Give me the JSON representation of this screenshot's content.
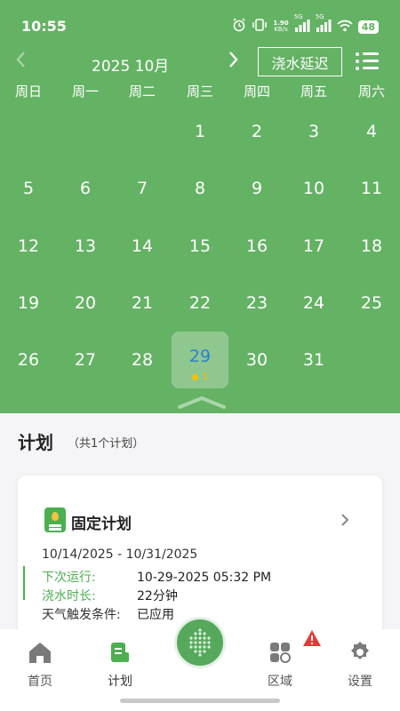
{
  "status_bar": {
    "time": "10:55",
    "speed_value": "1.90",
    "speed_unit": "KB/s",
    "signal_1": "5G",
    "signal_2": "5G",
    "battery": "48"
  },
  "calendar": {
    "month_label": "2025 10月",
    "delay_button": "浇水延迟",
    "weekdays": [
      "周日",
      "周一",
      "周二",
      "周三",
      "周四",
      "周五",
      "周六"
    ],
    "start_weekday_index": 3,
    "days_in_month": 31,
    "selected_day": "29",
    "selected_day_count": "1"
  },
  "plans": {
    "title": "计划",
    "count": "（共1个计划）",
    "card": {
      "name": "固定计划",
      "date_range": "10/14/2025 - 10/31/2025",
      "next_run_label": "下次运行:",
      "next_run_value": "10-29-2025 05:32 PM",
      "duration_label": "浇水时长:",
      "duration_value": "22分钟",
      "weather_label": "天气触发条件:",
      "weather_value": "已应用"
    }
  },
  "nav": {
    "home": "首页",
    "plan": "计划",
    "zone": "区域",
    "settings": "设置"
  },
  "colors": {
    "primary_green": "#64b264",
    "accent_green": "#4caf50",
    "today_blue": "#2a7fd6",
    "dot_yellow": "#f2c100",
    "warning_red": "#e53935"
  }
}
